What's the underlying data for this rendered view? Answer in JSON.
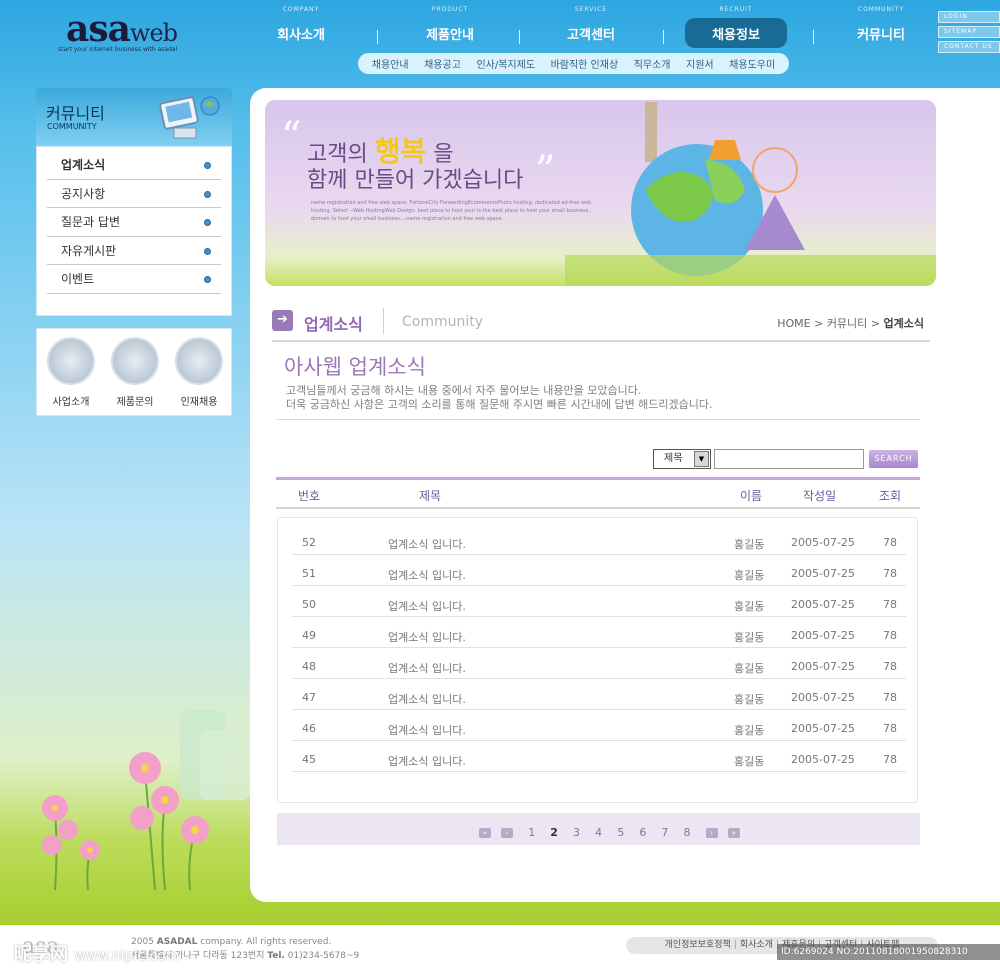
{
  "header": {
    "logo": {
      "main": "asa",
      "sub": "web",
      "tagline": "start your internet business with asadal"
    },
    "nav": [
      {
        "en": "COMPANY",
        "label": "회사소개"
      },
      {
        "en": "PRODUCT",
        "label": "제품안내"
      },
      {
        "en": "SERVICE",
        "label": "고객센터"
      },
      {
        "en": "RECRUIT",
        "label": "채용정보",
        "active": true
      },
      {
        "en": "COMMUNITY",
        "label": "커뮤니티"
      }
    ],
    "util": [
      "LOGIN",
      "SITEMAP",
      "CONTACT US"
    ],
    "subnav": [
      "채용안내",
      "채용공고",
      "인사/복지제도",
      "바람직한 인재상",
      "직무소개",
      "지원서",
      "채용도우미"
    ]
  },
  "sidebar": {
    "title": "커뮤니티",
    "subtitle": "COMMUNITY",
    "items": [
      "업계소식",
      "공지사항",
      "질문과 답변",
      "자유게시판",
      "이벤트"
    ],
    "quick": [
      "사업소개",
      "제품문의",
      "인재채용"
    ]
  },
  "banner": {
    "line1_pre": "고객의",
    "line1_highlight": "행복",
    "line1_post": "을",
    "line2": "함께 만들어 가겠습니다",
    "small": "name registration and free web space. FortuneCity ForwardingEcommercePhoto hosting, dedicated ad-free web hosting. Select --Web HostingWeb Design. best place to host your is the best place to host your small business... domain to host your small business....name registration and free web space."
  },
  "page": {
    "title": "업계소식",
    "title_en": "Community",
    "breadcrumb": {
      "home": "HOME",
      "sep1": ">",
      "parent": "커뮤니티",
      "sep2": ">",
      "current": "업계소식"
    }
  },
  "intro": {
    "title": "아사웹 업계소식",
    "desc1": "고객님들께서 궁금해 하시는 내용 중에서 자주 물어보는 내용만을 모았습니다.",
    "desc2": "더욱 궁금하신 사항은 고객의 소리를 통해 질문해 주시면 빠른 시간내에 답변 해드리겠습니다."
  },
  "search": {
    "select": "제목",
    "button": "SEARCH",
    "value": ""
  },
  "table": {
    "headers": {
      "no": "번호",
      "title": "제목",
      "name": "이름",
      "date": "작성일",
      "views": "조회"
    },
    "rows": [
      {
        "no": "52",
        "title": "업계소식 입니다.",
        "name": "홍길동",
        "date": "2005-07-25",
        "views": "78"
      },
      {
        "no": "51",
        "title": "업계소식 입니다.",
        "name": "홍길동",
        "date": "2005-07-25",
        "views": "78"
      },
      {
        "no": "50",
        "title": "업계소식 입니다.",
        "name": "홍길동",
        "date": "2005-07-25",
        "views": "78"
      },
      {
        "no": "49",
        "title": "업계소식 입니다.",
        "name": "홍길동",
        "date": "2005-07-25",
        "views": "78"
      },
      {
        "no": "48",
        "title": "업계소식 입니다.",
        "name": "홍길동",
        "date": "2005-07-25",
        "views": "78"
      },
      {
        "no": "47",
        "title": "업계소식 입니다.",
        "name": "홍길동",
        "date": "2005-07-25",
        "views": "78"
      },
      {
        "no": "46",
        "title": "업계소식 입니다.",
        "name": "홍길동",
        "date": "2005-07-25",
        "views": "78"
      },
      {
        "no": "45",
        "title": "업계소식 입니다.",
        "name": "홍길동",
        "date": "2005-07-25",
        "views": "78"
      }
    ]
  },
  "pager": {
    "pages": [
      "1",
      "2",
      "3",
      "4",
      "5",
      "6",
      "7",
      "8"
    ],
    "current": "2"
  },
  "footer": {
    "logo": "asa",
    "copy1_pre": "2005",
    "copy1_brand": "ASADAL",
    "copy1_post": "company. All rights reserved.",
    "copy2": "서울특별시 가나구 다라동 123번지",
    "tel_label": "Tel.",
    "tel": "01)234-5678~9",
    "links": [
      "개인정보보호정책",
      "회사소개",
      "제휴문의",
      "고객센터",
      "사이트맵"
    ]
  },
  "watermark": {
    "left": "昵享网",
    "left_url": "www.nipic.com",
    "right": "ID:6269024 NO:20110818001950828310"
  },
  "colors": {
    "accent": "#9a79b6",
    "sky": "#2da6e0",
    "grass": "#a6cf2e"
  }
}
